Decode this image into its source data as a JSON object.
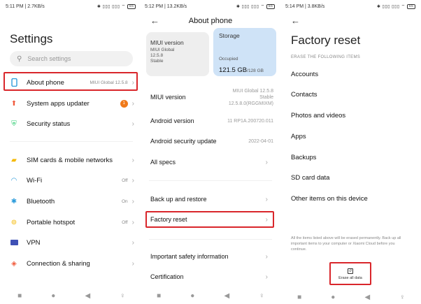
{
  "panel1": {
    "status": {
      "time": "5:11 PM | 2.7KB/s",
      "icons": "✱ ▯▯▯ ▯▯▯ ⌔",
      "battery": "55"
    },
    "title": "Settings",
    "search_placeholder": "Search settings",
    "items": [
      {
        "label": "About phone",
        "value": "MIUI Global 12.5.8",
        "icon": "phone-icon",
        "color": "#2d9cdb"
      },
      {
        "label": "System apps updater",
        "value": "",
        "badge": "1",
        "icon": "arrow-up-icon",
        "color": "#f05a3c"
      },
      {
        "label": "Security status",
        "value": "",
        "icon": "shield-check-icon",
        "color": "#2ecc71"
      },
      {
        "label": "SIM cards & mobile networks",
        "value": "",
        "icon": "sim-icon",
        "color": "#f5b800"
      },
      {
        "label": "Wi-Fi",
        "value": "Off",
        "icon": "wifi-icon",
        "color": "#2d9cdb"
      },
      {
        "label": "Bluetooth",
        "value": "On",
        "icon": "bluetooth-icon",
        "color": "#2d9cdb"
      },
      {
        "label": "Portable hotspot",
        "value": "Off",
        "icon": "hotspot-icon",
        "color": "#f5b800"
      },
      {
        "label": "VPN",
        "value": "",
        "icon": "vpn-icon",
        "color": "#3f51b5"
      },
      {
        "label": "Connection & sharing",
        "value": "",
        "icon": "share-icon",
        "color": "#f05a3c"
      }
    ]
  },
  "panel2": {
    "status": {
      "time": "5:12 PM | 13.2KB/s",
      "icons": "✱ ▯▯▯ ▯▯▯ ⌔",
      "battery": "55"
    },
    "title": "About phone",
    "miui_card": {
      "title": "MIUI version",
      "line1": "MIUI Global",
      "line2": "12.5.8",
      "line3": "Stable"
    },
    "storage_card": {
      "title": "Storage",
      "occupied_label": "Occupied",
      "used": "121.5 GB",
      "total": "/128 GB"
    },
    "rows": [
      {
        "label": "MIUI version",
        "value": "MIUI Global 12.5.8 Stable 12.5.8.0(RGGMIXM)"
      },
      {
        "label": "Android version",
        "value": "11 RP1A.200720.011"
      },
      {
        "label": "Android security update",
        "value": "2022-04-01"
      },
      {
        "label": "All specs",
        "value": ""
      },
      {
        "label": "Back up and restore",
        "value": ""
      },
      {
        "label": "Factory reset",
        "value": ""
      },
      {
        "label": "Important safety information",
        "value": ""
      },
      {
        "label": "Certification",
        "value": ""
      }
    ]
  },
  "panel3": {
    "status": {
      "time": "5:14 PM | 3.8KB/s",
      "icons": "✱ ▯▯▯ ▯▯▯ ⌔",
      "battery": "55"
    },
    "title": "Factory reset",
    "subtitle": "ERASE THE FOLLOWING ITEMS",
    "items": [
      "Accounts",
      "Contacts",
      "Photos and videos",
      "Apps",
      "Backups",
      "SD card data",
      "Other items on this device"
    ],
    "warning": "All the items listed above will be erased permanently. Back up all important items to your computer or Xiaomi Cloud before you continue.",
    "erase_label": "Erase all data"
  },
  "colors": {
    "highlight": "#d9262b",
    "storage_card": "#cfe3f7",
    "miui_card": "#eeeeee"
  }
}
